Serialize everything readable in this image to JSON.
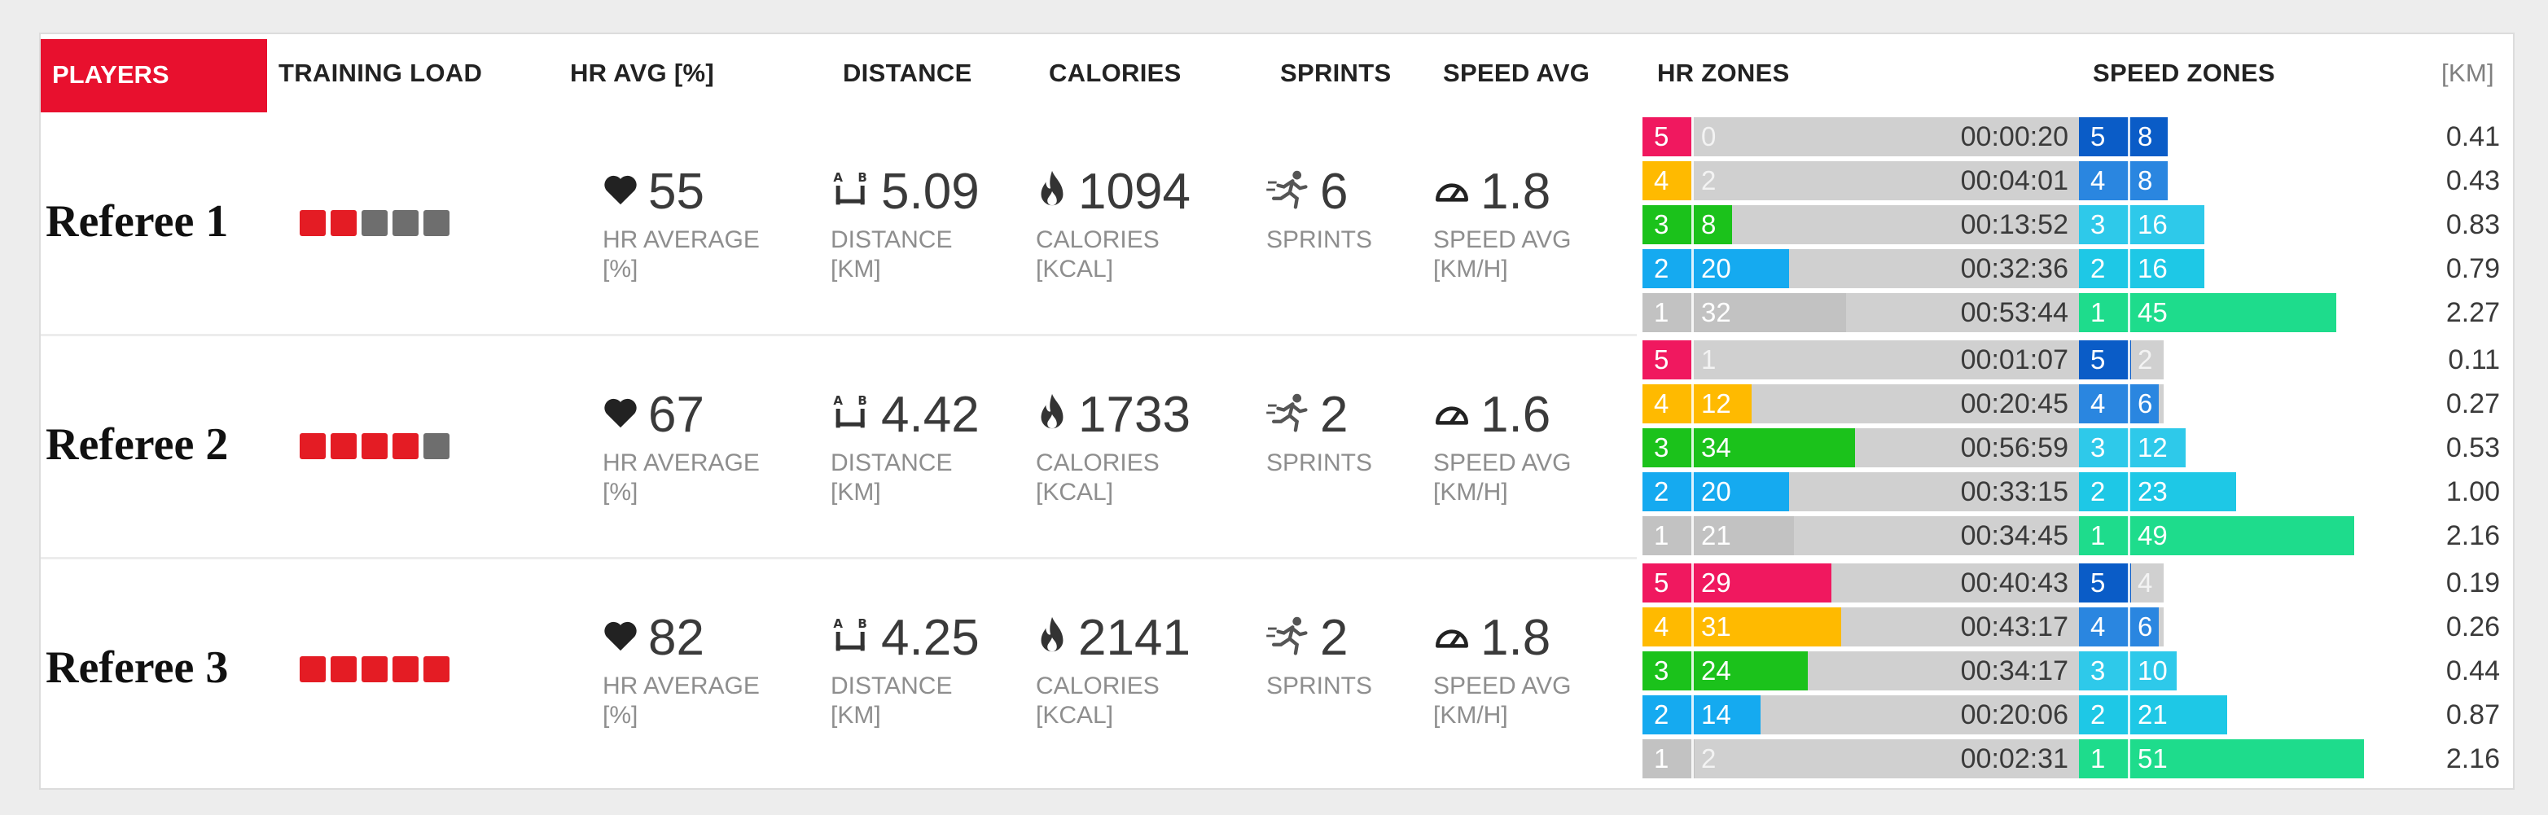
{
  "headers": {
    "players": "PLAYERS",
    "training_load": "TRAINING LOAD",
    "hr_avg": "HR AVG [%]",
    "distance": "DISTANCE",
    "calories": "CALORIES",
    "sprints": "SPRINTS",
    "speed_avg": "SPEED AVG",
    "hr_zones": "HR ZONES",
    "speed_zones": "SPEED ZONES",
    "km": "[KM]"
  },
  "labels": {
    "hr_average": "HR AVERAGE",
    "hr_unit": "[%]",
    "distance": "DISTANCE",
    "distance_unit": "[KM]",
    "calories": "CALORIES",
    "calories_unit": "[KCAL]",
    "sprints": "SPRINTS",
    "speed_avg": "SPEED AVG",
    "speed_unit": "[KM/H]"
  },
  "colors": {
    "accent": "#e8102e",
    "load_on": "#e41c24",
    "load_off": "#6e6e6e",
    "hr_zone_5": "#f0185f",
    "hr_zone_4": "#ffba00",
    "hr_zone_3": "#1bc21b",
    "hr_zone_2": "#15aaf0",
    "hr_zone_1": "#c2c2c2",
    "speed_zone_5": "#0a5cc7",
    "speed_zone_4": "#2a86e0",
    "speed_zone_3": "#2ec9ea",
    "speed_zone_2": "#1ec8e6",
    "speed_zone_1": "#1edc8c"
  },
  "icons": {
    "hr": "heart-icon",
    "distance": "a-to-b-distance-icon",
    "calories": "flame-icon",
    "sprints": "sprinter-icon",
    "speed": "speedometer-icon"
  },
  "referees": [
    {
      "name": "Referee 1",
      "load_filled": 2,
      "load_total": 5,
      "hr_avg": "55",
      "distance": "5.09",
      "calories": "1094",
      "sprints": "6",
      "speed_avg": "1.8",
      "zones": [
        {
          "hr_zone": "5",
          "hr_value": "0",
          "hr_fill": 0.0,
          "time": "00:00:20",
          "speed_zone": "5",
          "speed_value": "8",
          "speed_fill": 0.08,
          "km": "0.41"
        },
        {
          "hr_zone": "4",
          "hr_value": "2",
          "hr_fill": 0.0,
          "time": "00:04:01",
          "speed_zone": "4",
          "speed_value": "8",
          "speed_fill": 0.08,
          "km": "0.43"
        },
        {
          "hr_zone": "3",
          "hr_value": "8",
          "hr_fill": 0.08,
          "time": "00:13:52",
          "speed_zone": "3",
          "speed_value": "16",
          "speed_fill": 0.16,
          "km": "0.83"
        },
        {
          "hr_zone": "2",
          "hr_value": "20",
          "hr_fill": 0.2,
          "time": "00:32:36",
          "speed_zone": "2",
          "speed_value": "16",
          "speed_fill": 0.16,
          "km": "0.79"
        },
        {
          "hr_zone": "1",
          "hr_value": "32",
          "hr_fill": 0.32,
          "time": "00:53:44",
          "speed_zone": "1",
          "speed_value": "45",
          "speed_fill": 0.45,
          "km": "2.27"
        }
      ]
    },
    {
      "name": "Referee 2",
      "load_filled": 4,
      "load_total": 5,
      "hr_avg": "67",
      "distance": "4.42",
      "calories": "1733",
      "sprints": "2",
      "speed_avg": "1.6",
      "zones": [
        {
          "hr_zone": "5",
          "hr_value": "1",
          "hr_fill": 0.0,
          "time": "00:01:07",
          "speed_zone": "5",
          "speed_value": "2",
          "speed_fill": 0.0,
          "km": "0.11"
        },
        {
          "hr_zone": "4",
          "hr_value": "12",
          "hr_fill": 0.12,
          "time": "00:20:45",
          "speed_zone": "4",
          "speed_value": "6",
          "speed_fill": 0.06,
          "km": "0.27"
        },
        {
          "hr_zone": "3",
          "hr_value": "34",
          "hr_fill": 0.34,
          "time": "00:56:59",
          "speed_zone": "3",
          "speed_value": "12",
          "speed_fill": 0.12,
          "km": "0.53"
        },
        {
          "hr_zone": "2",
          "hr_value": "20",
          "hr_fill": 0.2,
          "time": "00:33:15",
          "speed_zone": "2",
          "speed_value": "23",
          "speed_fill": 0.23,
          "km": "1.00"
        },
        {
          "hr_zone": "1",
          "hr_value": "21",
          "hr_fill": 0.21,
          "time": "00:34:45",
          "speed_zone": "1",
          "speed_value": "49",
          "speed_fill": 0.49,
          "km": "2.16"
        }
      ]
    },
    {
      "name": "Referee 3",
      "load_filled": 5,
      "load_total": 5,
      "hr_avg": "82",
      "distance": "4.25",
      "calories": "2141",
      "sprints": "2",
      "speed_avg": "1.8",
      "zones": [
        {
          "hr_zone": "5",
          "hr_value": "29",
          "hr_fill": 0.29,
          "time": "00:40:43",
          "speed_zone": "5",
          "speed_value": "4",
          "speed_fill": 0.0,
          "km": "0.19"
        },
        {
          "hr_zone": "4",
          "hr_value": "31",
          "hr_fill": 0.31,
          "time": "00:43:17",
          "speed_zone": "4",
          "speed_value": "6",
          "speed_fill": 0.06,
          "km": "0.26"
        },
        {
          "hr_zone": "3",
          "hr_value": "24",
          "hr_fill": 0.24,
          "time": "00:34:17",
          "speed_zone": "3",
          "speed_value": "10",
          "speed_fill": 0.1,
          "km": "0.44"
        },
        {
          "hr_zone": "2",
          "hr_value": "14",
          "hr_fill": 0.14,
          "time": "00:20:06",
          "speed_zone": "2",
          "speed_value": "21",
          "speed_fill": 0.21,
          "km": "0.87"
        },
        {
          "hr_zone": "1",
          "hr_value": "2",
          "hr_fill": 0.0,
          "time": "00:02:31",
          "speed_zone": "1",
          "speed_value": "51",
          "speed_fill": 0.51,
          "km": "2.16"
        }
      ]
    }
  ]
}
